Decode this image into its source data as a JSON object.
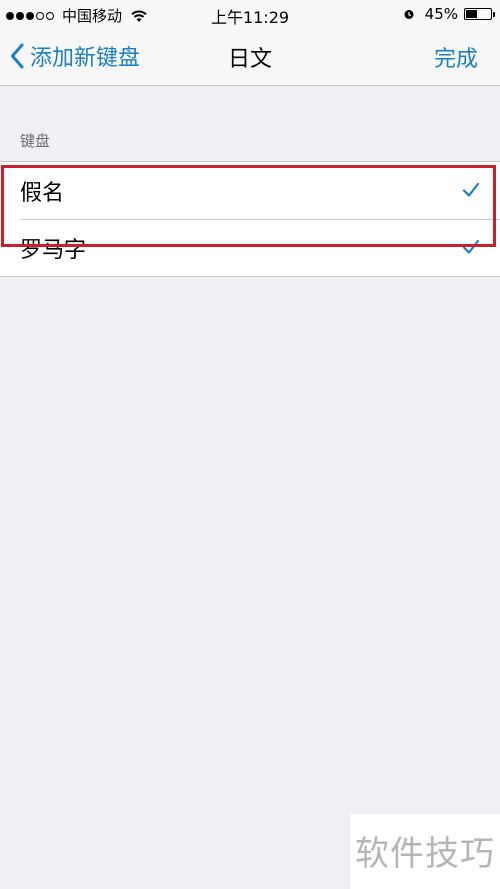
{
  "status_bar": {
    "carrier": "中国移动",
    "signal_filled": 3,
    "signal_total": 5,
    "time": "上午11:29",
    "battery_percent": "45%",
    "battery_level": 0.45
  },
  "nav": {
    "back_label": "添加新键盘",
    "title": "日文",
    "done_label": "完成"
  },
  "section": {
    "header": "键盘",
    "items": [
      {
        "label": "假名",
        "checked": true
      },
      {
        "label": "罗马字",
        "checked": true
      }
    ]
  },
  "watermark": "软件技巧",
  "colors": {
    "accent": "#1a7fc5",
    "highlight": "#c8202f",
    "background": "#efeff4"
  }
}
